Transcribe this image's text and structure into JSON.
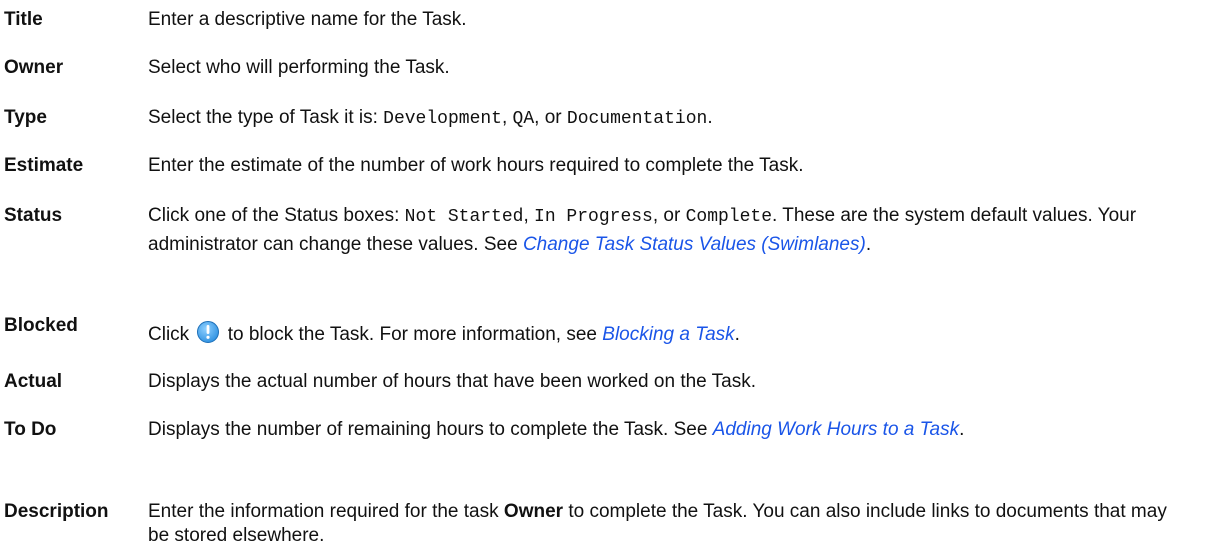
{
  "fields": {
    "title": {
      "term": "Title",
      "text": "Enter a descriptive name for the Task."
    },
    "owner": {
      "term": "Owner",
      "text": "Select who will performing the Task."
    },
    "type": {
      "term": "Type",
      "pre": "Select the type of Task it is: ",
      "opt1": "Development",
      "sep1": ", ",
      "opt2": "QA",
      "sep2": ", or ",
      "opt3": "Documentation",
      "post": "."
    },
    "estimate": {
      "term": "Estimate",
      "text": "Enter the estimate of the number of work hours required to complete the Task."
    },
    "status": {
      "term": "Status",
      "pre": "Click one of the Status boxes: ",
      "opt1": "Not Started",
      "sep1": ", ",
      "opt2": "In Progress",
      "sep2": ", or ",
      "opt3": "Complete",
      "mid": ". These are the system default values. Your administrator can change these values. See ",
      "link": "Change Task Status Values (Swimlanes)",
      "post": "."
    },
    "blocked": {
      "term": "Blocked",
      "pre": "Click ",
      "icon": "blocked-exclamation-icon",
      "mid": " to block the Task. For more information, see ",
      "link": "Blocking a Task",
      "post": "."
    },
    "actual": {
      "term": "Actual",
      "text": "Displays the actual number of hours that have been worked on the Task."
    },
    "todo": {
      "term": "To Do",
      "pre": "Displays the number of remaining hours to complete the Task. See ",
      "link": "Adding Work Hours to a Task",
      "post": "."
    },
    "description": {
      "term": "Description",
      "pre": "Enter the information required for the task ",
      "bold": "Owner",
      "post": " to complete the Task. You can also include links to documents that may be stored elsewhere."
    }
  },
  "colors": {
    "link": "#1a55e8",
    "icon_fill": "#2b8fe0",
    "text": "#111111"
  }
}
